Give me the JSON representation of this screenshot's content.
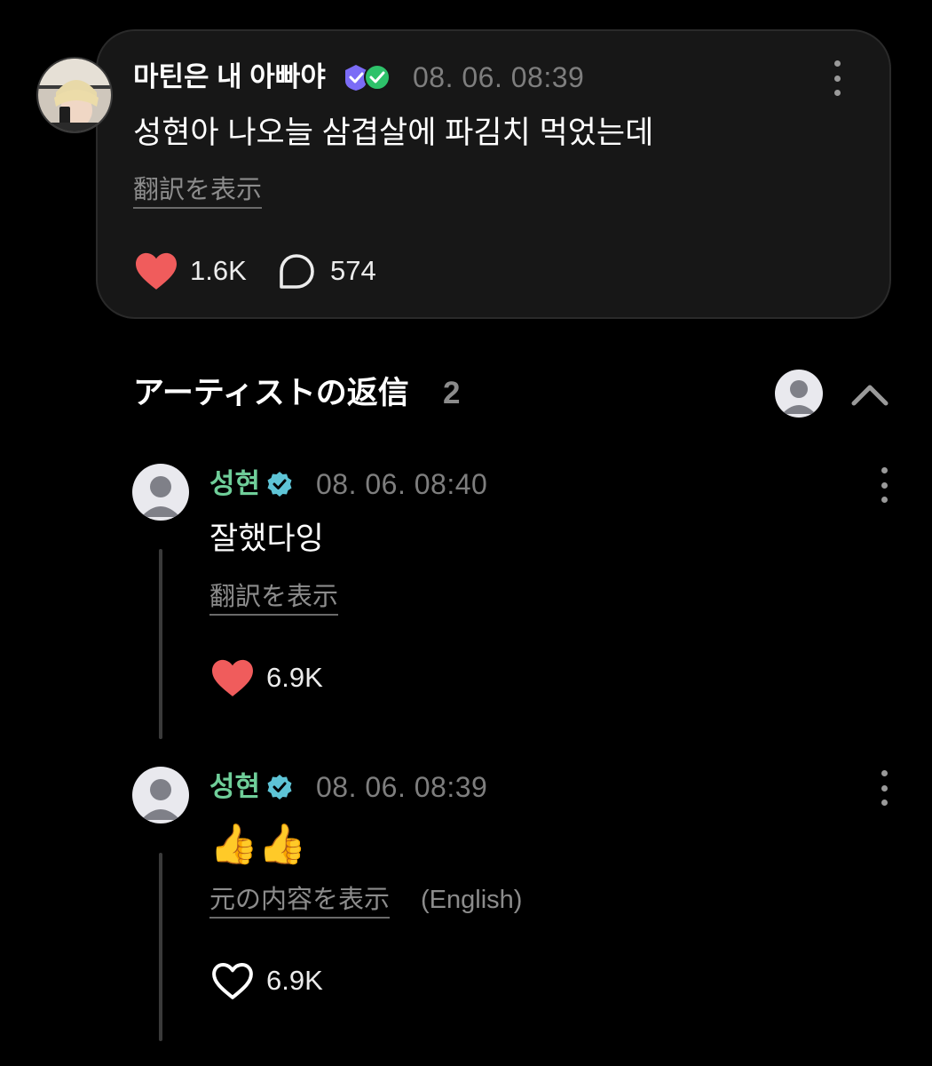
{
  "post": {
    "username": "마틴은 내 아빠야",
    "timestamp": "08. 06. 08:39",
    "text": "성현아 나오늘 삼겹살에 파김치 먹었는데",
    "translate_label": "翻訳を表示",
    "likes": "1.6K",
    "comments": "574",
    "like_icon": "heart-filled-icon",
    "comment_icon": "speech-bubble-icon",
    "badge_colors": [
      "#7b6cf6",
      "#2ec26a"
    ]
  },
  "artist_replies": {
    "title": "アーティストの返信",
    "count": "2",
    "replies": [
      {
        "name": "성현",
        "timestamp": "08. 06. 08:40",
        "text": "잘했다잉",
        "translate_label": "翻訳を表示",
        "likes": "6.9K",
        "liked": true
      },
      {
        "name": "성현",
        "timestamp": "08. 06. 08:39",
        "text": "👍👍",
        "translate_label": "元の内容を表示",
        "lang_note": "(English)",
        "likes": "6.9K",
        "liked": false
      }
    ]
  },
  "colors": {
    "background": "#000000",
    "card": "#171717",
    "heart": "#f05c5c",
    "artist_name": "#6fce99",
    "verified": "#5ec4d6",
    "muted": "#7e7e7e"
  }
}
